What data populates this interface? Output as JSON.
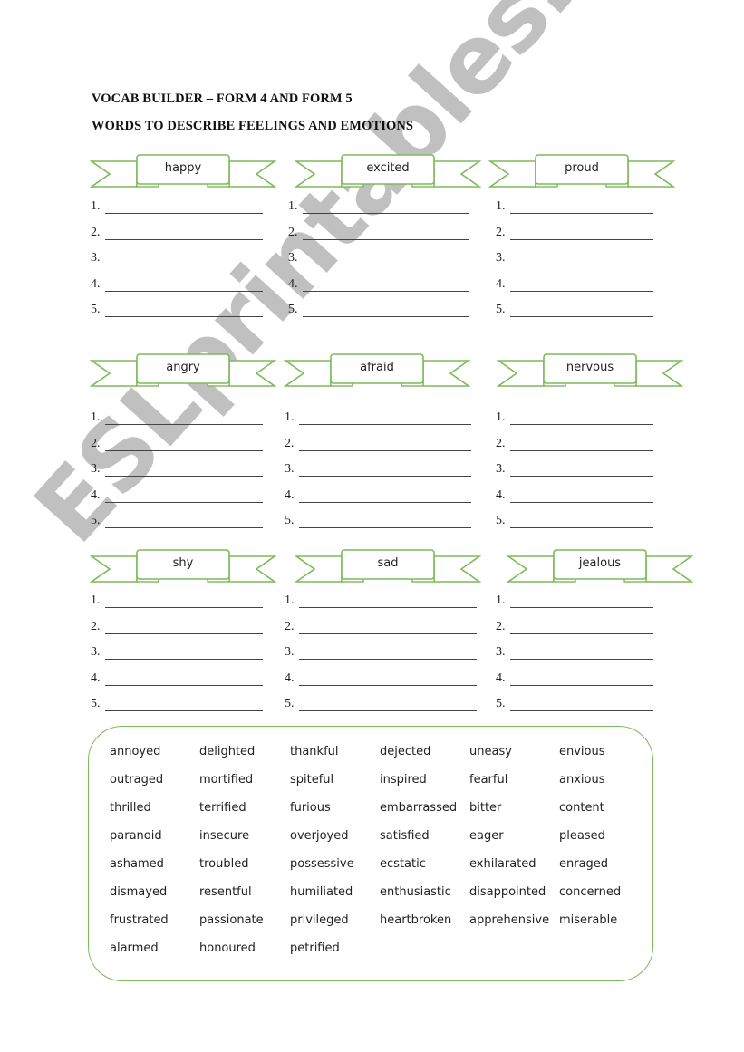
{
  "document": {
    "title": "VOCAB BUILDER – FORM 4 AND FORM 5",
    "subtitle": "WORDS TO DESCRIBE FEELINGS AND EMOTIONS"
  },
  "accent_color": "#7dba5a",
  "line_numbers": [
    "1.",
    "2.",
    "3.",
    "4.",
    "5."
  ],
  "categories": [
    {
      "label": "happy"
    },
    {
      "label": "excited"
    },
    {
      "label": "proud"
    },
    {
      "label": "angry"
    },
    {
      "label": "afraid"
    },
    {
      "label": "nervous"
    },
    {
      "label": "shy"
    },
    {
      "label": "sad"
    },
    {
      "label": "jealous"
    }
  ],
  "word_bank": {
    "rows": [
      [
        "annoyed",
        "delighted",
        "thankful",
        "dejected",
        "uneasy",
        "envious"
      ],
      [
        "outraged",
        "mortified",
        "spiteful",
        "inspired",
        "fearful",
        "anxious"
      ],
      [
        "thrilled",
        "terrified",
        "furious",
        "embarrassed",
        "bitter",
        "content"
      ],
      [
        "paranoid",
        "insecure",
        "overjoyed",
        "satisfied",
        "eager",
        "pleased"
      ],
      [
        "ashamed",
        "troubled",
        "possessive",
        "ecstatic",
        "exhilarated",
        "enraged"
      ],
      [
        "dismayed",
        "resentful",
        "humiliated",
        "enthusiastic",
        "disappointed",
        "concerned"
      ],
      [
        "frustrated",
        "passionate",
        "privileged",
        "heartbroken",
        "apprehensive",
        "miserable"
      ],
      [
        "alarmed",
        "honoured",
        "petrified",
        "",
        "",
        ""
      ]
    ]
  },
  "watermark": "ESLprintables.com"
}
